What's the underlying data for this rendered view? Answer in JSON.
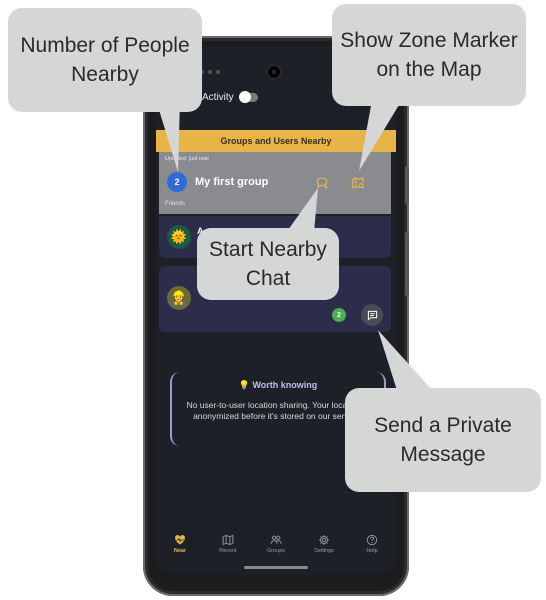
{
  "header": {
    "activity_label": "Activity",
    "section_title": "Groups and Users Nearby"
  },
  "group": {
    "updated_text": "Updated: just now",
    "count": "2",
    "name": "My first group",
    "subtitle": "Friends"
  },
  "users": [
    {
      "name": "A",
      "avatar": "🌞"
    },
    {
      "name": "",
      "avatar": "👷",
      "nearby_count": "2"
    }
  ],
  "info": {
    "title_icon": "💡",
    "title": "Worth knowing",
    "text": "No user-to-user location sharing. Your location is anonymized before it's stored on our servers."
  },
  "nav": [
    {
      "label": "Near",
      "icon": "heart-pulse-icon",
      "active": true
    },
    {
      "label": "Recent",
      "icon": "map-icon"
    },
    {
      "label": "Groups",
      "icon": "people-icon"
    },
    {
      "label": "Settings",
      "icon": "gear-icon"
    },
    {
      "label": "Help",
      "icon": "help-icon"
    }
  ],
  "callouts": {
    "people_nearby": "Number of People Nearby",
    "zone_marker": "Show Zone Marker on the Map",
    "nearby_chat": "Start Nearby Chat",
    "private_message": "Send a Private Message"
  },
  "colors": {
    "accent": "#e7b547",
    "group_avatar": "#2f6bd8",
    "count_badge": "#4caf50",
    "callout": "#d4d7d6"
  }
}
